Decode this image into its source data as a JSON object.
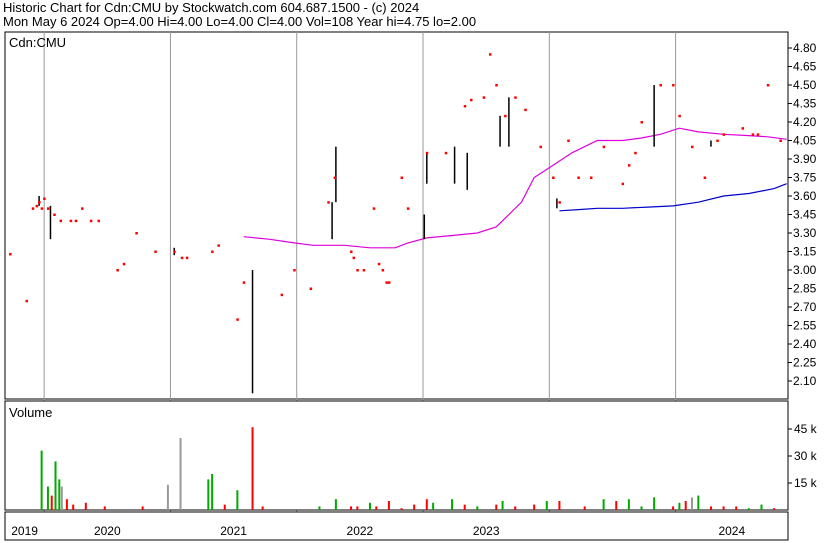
{
  "header": {
    "line1": "Historic Chart for Cdn:CMU by Stockwatch.com 604.687.1500 - (c) 2024",
    "line2": "Mon May  6 2024  Op=4.00  Hi=4.00  Lo=4.00  Cl=4.00  Vol=108  Year hi=4.75  lo=2.00"
  },
  "colors": {
    "price_point": "#ff0000",
    "range_bar": "#000000",
    "ma_long": "#dd00dd",
    "ma_short": "#0000cc",
    "vol_up": "#00aa00",
    "vol_down": "#ff0000",
    "vol_neutral": "#999999",
    "grid": "#999999"
  },
  "chart_data": [
    {
      "type": "line",
      "title": "Cdn:CMU",
      "y_ticks": [
        "4.80",
        "4.65",
        "4.50",
        "4.35",
        "4.20",
        "4.05",
        "3.90",
        "3.75",
        "3.60",
        "3.45",
        "3.30",
        "3.15",
        "3.00",
        "2.85",
        "2.70",
        "2.55",
        "2.40",
        "2.25",
        "2.10"
      ],
      "ylim": [
        2.0,
        4.85
      ],
      "x_ticks": [
        "2019",
        "2020",
        "2021",
        "2022",
        "2023",
        "2024"
      ],
      "grid": true,
      "price_points": [
        [
          2018.7,
          3.13
        ],
        [
          2018.83,
          2.75
        ],
        [
          2018.88,
          3.5
        ],
        [
          2018.91,
          3.52
        ],
        [
          2018.93,
          3.55
        ],
        [
          2018.95,
          3.5
        ],
        [
          2018.97,
          3.58
        ],
        [
          2019.0,
          3.5
        ],
        [
          2019.05,
          3.45
        ],
        [
          2019.1,
          3.4
        ],
        [
          2019.18,
          3.4
        ],
        [
          2019.22,
          3.4
        ],
        [
          2019.27,
          3.5
        ],
        [
          2019.34,
          3.4
        ],
        [
          2019.4,
          3.4
        ],
        [
          2019.55,
          3.0
        ],
        [
          2019.6,
          3.05
        ],
        [
          2019.7,
          3.3
        ],
        [
          2019.85,
          3.15
        ],
        [
          2020.0,
          3.15
        ],
        [
          2020.06,
          3.1
        ],
        [
          2020.1,
          3.1
        ],
        [
          2020.3,
          3.15
        ],
        [
          2020.35,
          3.2
        ],
        [
          2020.5,
          2.6
        ],
        [
          2020.55,
          2.9
        ],
        [
          2020.85,
          2.8
        ],
        [
          2020.95,
          3.0
        ],
        [
          2021.08,
          2.85
        ],
        [
          2021.22,
          3.55
        ],
        [
          2021.27,
          3.75
        ],
        [
          2021.4,
          3.15
        ],
        [
          2021.42,
          3.1
        ],
        [
          2021.45,
          3.0
        ],
        [
          2021.5,
          3.0
        ],
        [
          2021.58,
          3.5
        ],
        [
          2021.62,
          3.05
        ],
        [
          2021.65,
          3.0
        ],
        [
          2021.68,
          2.9
        ],
        [
          2021.7,
          2.9
        ],
        [
          2021.8,
          3.75
        ],
        [
          2021.85,
          3.5
        ],
        [
          2022.0,
          3.95
        ],
        [
          2022.15,
          3.95
        ],
        [
          2022.3,
          4.33
        ],
        [
          2022.35,
          4.38
        ],
        [
          2022.45,
          4.4
        ],
        [
          2022.5,
          4.75
        ],
        [
          2022.55,
          4.5
        ],
        [
          2022.62,
          4.25
        ],
        [
          2022.7,
          4.4
        ],
        [
          2022.78,
          4.3
        ],
        [
          2022.9,
          4.0
        ],
        [
          2023.0,
          3.75
        ],
        [
          2023.05,
          3.55
        ],
        [
          2023.12,
          4.05
        ],
        [
          2023.2,
          3.75
        ],
        [
          2023.3,
          3.75
        ],
        [
          2023.4,
          4.0
        ],
        [
          2023.55,
          3.7
        ],
        [
          2023.6,
          3.85
        ],
        [
          2023.65,
          3.95
        ],
        [
          2023.7,
          4.2
        ],
        [
          2023.85,
          4.5
        ],
        [
          2023.95,
          4.5
        ],
        [
          2024.0,
          4.25
        ],
        [
          2024.1,
          4.0
        ],
        [
          2024.2,
          3.75
        ],
        [
          2024.3,
          4.05
        ],
        [
          2024.35,
          4.1
        ],
        [
          2024.5,
          4.15
        ],
        [
          2024.58,
          4.1
        ],
        [
          2024.62,
          4.1
        ],
        [
          2024.7,
          4.5
        ],
        [
          2024.8,
          4.05
        ]
      ],
      "range_bars": [
        [
          2018.93,
          3.52,
          3.6
        ],
        [
          2019.02,
          3.25,
          3.52
        ],
        [
          2020.0,
          3.12,
          3.18
        ],
        [
          2020.62,
          2.0,
          3.0
        ],
        [
          2021.25,
          3.25,
          3.55
        ],
        [
          2021.28,
          3.55,
          4.0
        ],
        [
          2021.98,
          3.25,
          3.45
        ],
        [
          2022.0,
          3.7,
          3.95
        ],
        [
          2022.22,
          3.7,
          4.0
        ],
        [
          2022.32,
          3.65,
          3.95
        ],
        [
          2022.58,
          4.0,
          4.25
        ],
        [
          2022.65,
          4.0,
          4.4
        ],
        [
          2023.03,
          3.5,
          3.58
        ],
        [
          2023.8,
          4.0,
          4.5
        ],
        [
          2024.25,
          4.0,
          4.05
        ]
      ],
      "ma_long": {
        "x": [
          2020.55,
          2020.75,
          2020.95,
          2021.1,
          2021.35,
          2021.55,
          2021.75,
          2021.85,
          2022.0,
          2022.2,
          2022.4,
          2022.55,
          2022.65,
          2022.75,
          2022.85,
          2023.0,
          2023.15,
          2023.35,
          2023.55,
          2023.7,
          2023.85,
          2024.0,
          2024.15,
          2024.35,
          2024.55,
          2024.7,
          2024.85
        ],
        "y": [
          3.27,
          3.25,
          3.22,
          3.2,
          3.2,
          3.18,
          3.18,
          3.22,
          3.26,
          3.28,
          3.3,
          3.35,
          3.45,
          3.55,
          3.75,
          3.85,
          3.95,
          4.05,
          4.05,
          4.07,
          4.1,
          4.15,
          4.12,
          4.1,
          4.09,
          4.08,
          4.06
        ]
      },
      "ma_short": {
        "x": [
          2023.05,
          2023.2,
          2023.35,
          2023.55,
          2023.75,
          2023.95,
          2024.15,
          2024.35,
          2024.55,
          2024.75,
          2024.85
        ],
        "y": [
          3.48,
          3.49,
          3.5,
          3.5,
          3.51,
          3.52,
          3.55,
          3.6,
          3.62,
          3.66,
          3.7
        ]
      }
    },
    {
      "type": "bar",
      "title": "Volume",
      "y_ticks": [
        "45 k",
        "30 k",
        "15 k"
      ],
      "ylim": [
        0,
        50000
      ],
      "x_ticks": [
        "2019",
        "2020",
        "2021",
        "2022",
        "2023",
        "2024"
      ],
      "bars": [
        [
          2018.95,
          33000,
          "up"
        ],
        [
          2019.0,
          13000,
          "up"
        ],
        [
          2019.03,
          8000,
          "down"
        ],
        [
          2019.06,
          27000,
          "up"
        ],
        [
          2019.09,
          17000,
          "up"
        ],
        [
          2019.11,
          13000,
          "neutral"
        ],
        [
          2019.15,
          6000,
          "down"
        ],
        [
          2019.2,
          3000,
          "down"
        ],
        [
          2019.3,
          4000,
          "down"
        ],
        [
          2019.45,
          2000,
          "down"
        ],
        [
          2019.75,
          2000,
          "down"
        ],
        [
          2019.95,
          14000,
          "neutral"
        ],
        [
          2020.05,
          40000,
          "neutral"
        ],
        [
          2020.27,
          17000,
          "up"
        ],
        [
          2020.3,
          20000,
          "up"
        ],
        [
          2020.4,
          3000,
          "down"
        ],
        [
          2020.5,
          11000,
          "up"
        ],
        [
          2020.62,
          46000,
          "down"
        ],
        [
          2020.7,
          2000,
          "down"
        ],
        [
          2021.15,
          2000,
          "up"
        ],
        [
          2021.28,
          6000,
          "up"
        ],
        [
          2021.4,
          2000,
          "down"
        ],
        [
          2021.45,
          2000,
          "down"
        ],
        [
          2021.55,
          4000,
          "up"
        ],
        [
          2021.6,
          2000,
          "down"
        ],
        [
          2021.7,
          5000,
          "down"
        ],
        [
          2021.8,
          1000,
          "down"
        ],
        [
          2021.9,
          3000,
          "down"
        ],
        [
          2022.0,
          6000,
          "down"
        ],
        [
          2022.05,
          4000,
          "up"
        ],
        [
          2022.2,
          6000,
          "up"
        ],
        [
          2022.3,
          3000,
          "down"
        ],
        [
          2022.4,
          2000,
          "up"
        ],
        [
          2022.55,
          3000,
          "down"
        ],
        [
          2022.6,
          5000,
          "up"
        ],
        [
          2022.7,
          2000,
          "down"
        ],
        [
          2022.85,
          3000,
          "down"
        ],
        [
          2022.95,
          5000,
          "up"
        ],
        [
          2023.05,
          5000,
          "down"
        ],
        [
          2023.25,
          2000,
          "down"
        ],
        [
          2023.4,
          6000,
          "up"
        ],
        [
          2023.5,
          5000,
          "down"
        ],
        [
          2023.6,
          6000,
          "up"
        ],
        [
          2023.7,
          2000,
          "up"
        ],
        [
          2023.8,
          7000,
          "up"
        ],
        [
          2023.95,
          2000,
          "down"
        ],
        [
          2024.0,
          4000,
          "up"
        ],
        [
          2024.05,
          5000,
          "down"
        ],
        [
          2024.1,
          7000,
          "neutral"
        ],
        [
          2024.15,
          8000,
          "up"
        ],
        [
          2024.25,
          2000,
          "down"
        ],
        [
          2024.35,
          2000,
          "down"
        ],
        [
          2024.45,
          2000,
          "down"
        ],
        [
          2024.55,
          1000,
          "up"
        ],
        [
          2024.65,
          3000,
          "up"
        ],
        [
          2024.75,
          1000,
          "down"
        ]
      ]
    }
  ]
}
